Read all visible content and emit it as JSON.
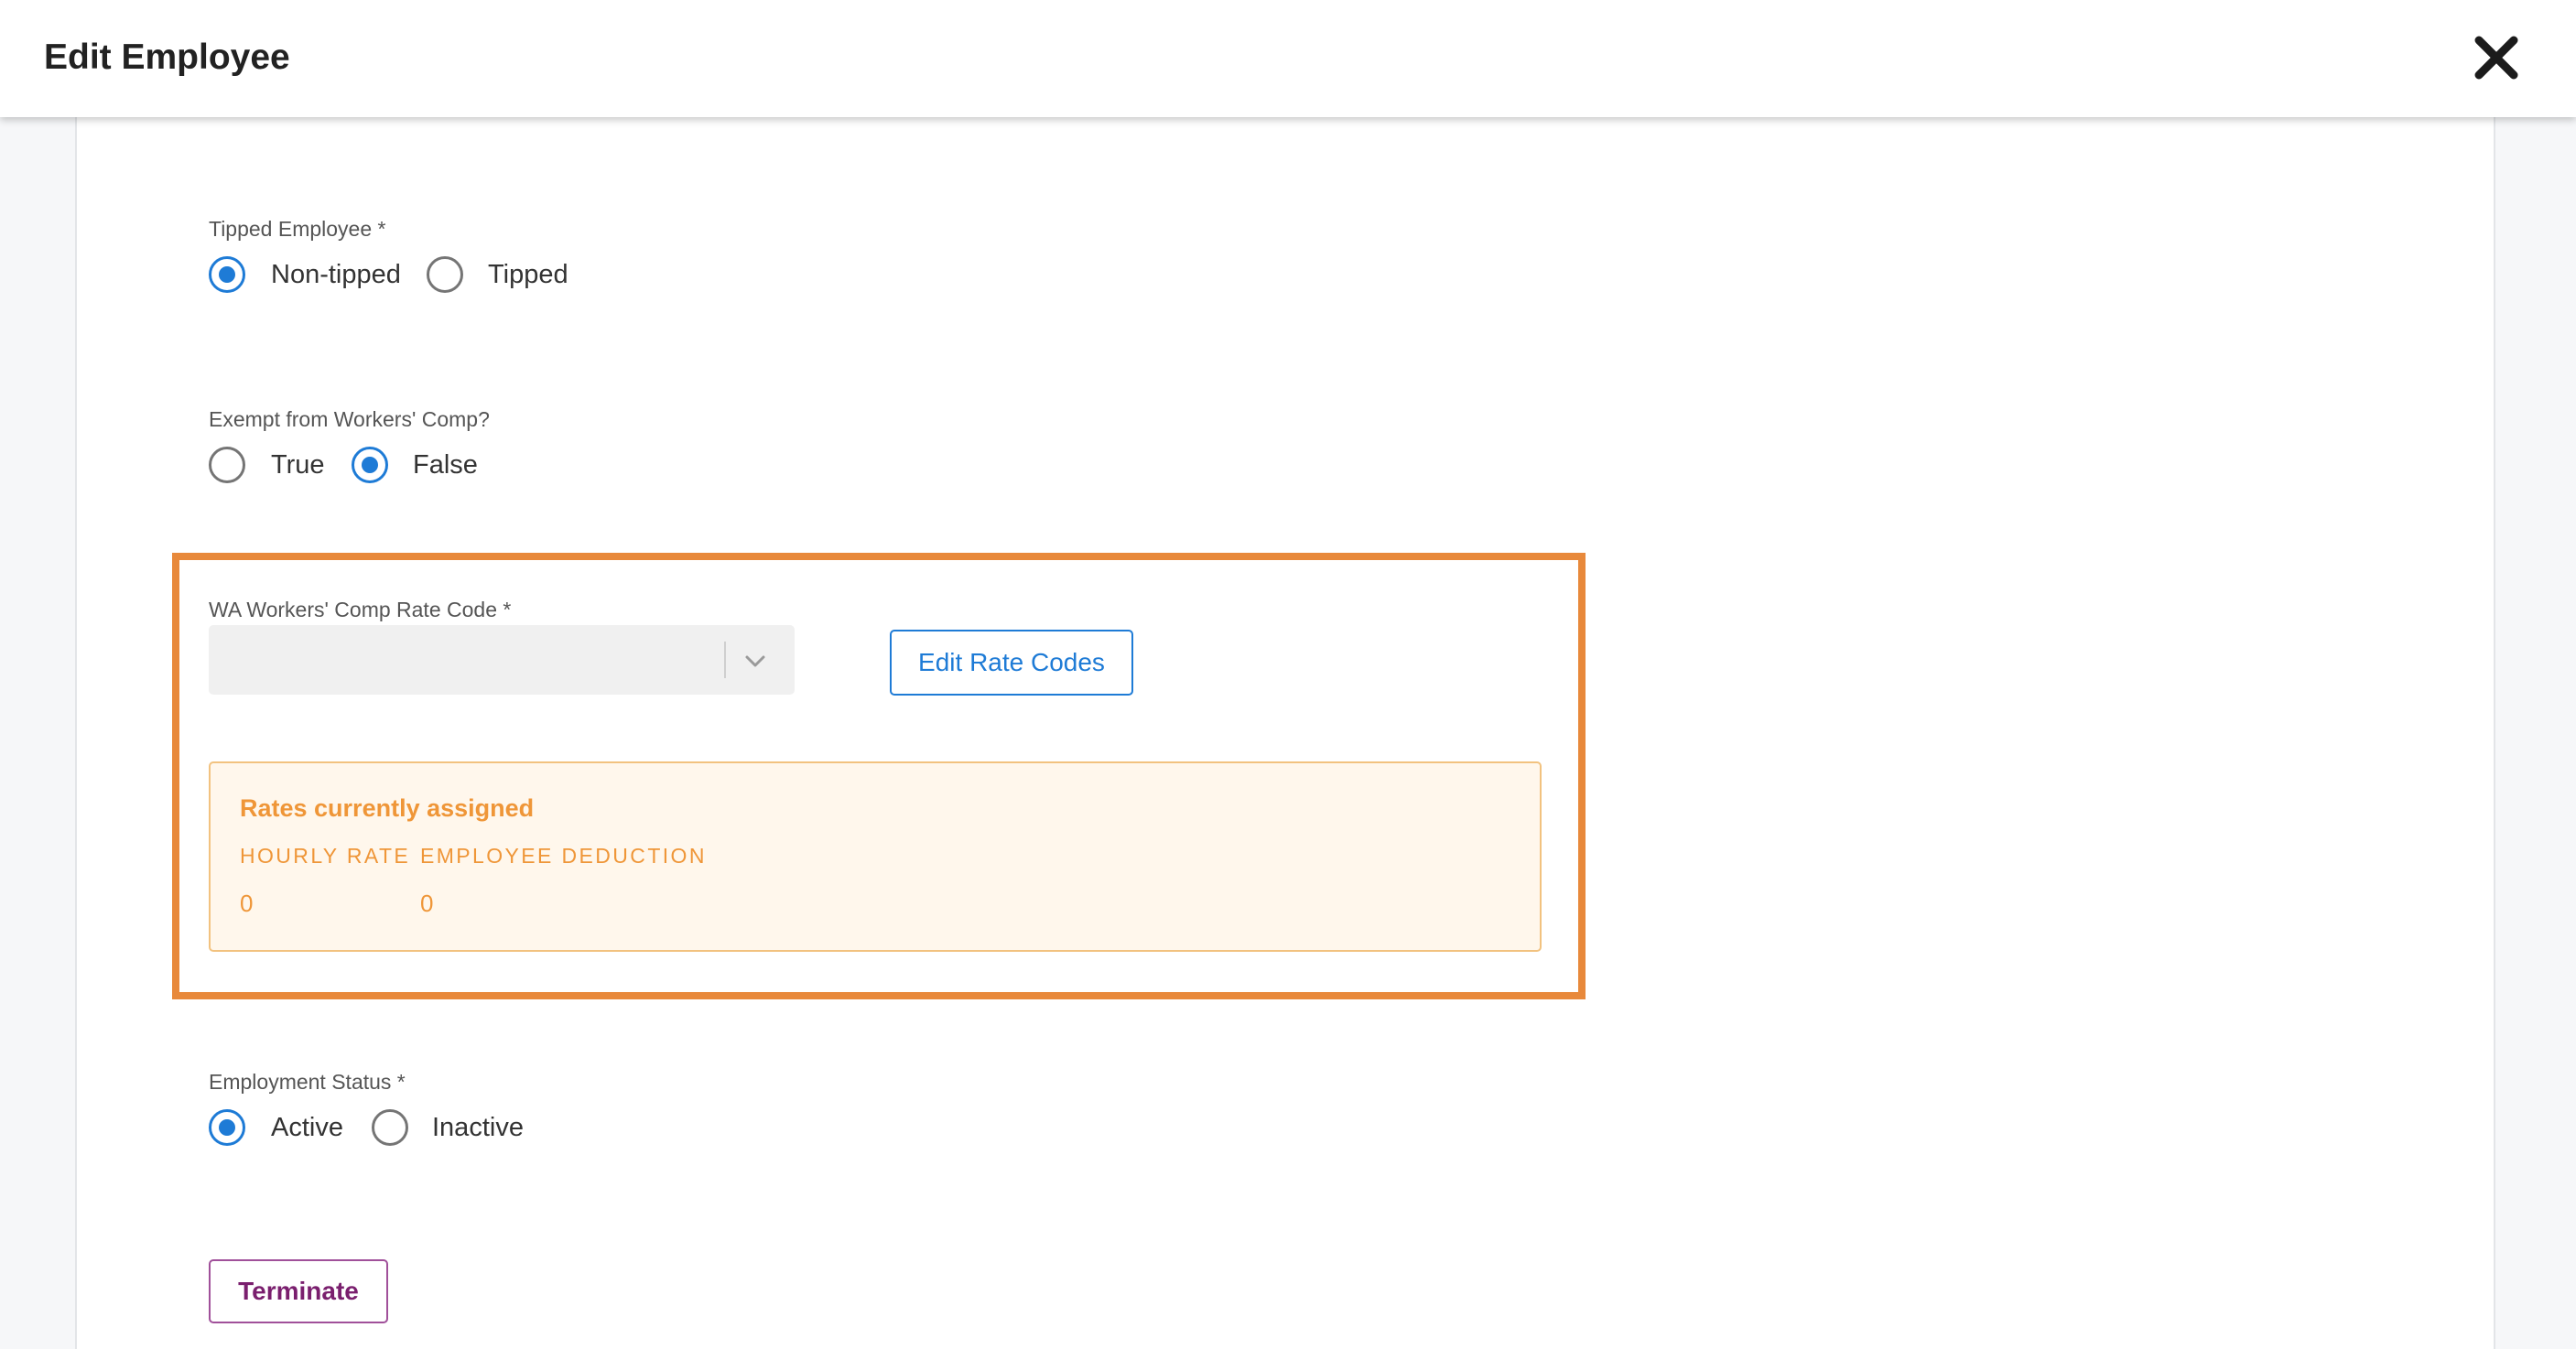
{
  "header": {
    "title": "Edit Employee",
    "close_icon": "close-icon"
  },
  "tipped": {
    "label": "Tipped Employee *",
    "options": [
      {
        "label": "Non-tipped",
        "selected": true
      },
      {
        "label": "Tipped",
        "selected": false
      }
    ]
  },
  "workers_comp_exempt": {
    "label": "Exempt from Workers' Comp?",
    "options": [
      {
        "label": "True",
        "selected": false
      },
      {
        "label": "False",
        "selected": true
      }
    ]
  },
  "rate_code": {
    "label": "WA Workers' Comp Rate Code *",
    "value": "",
    "edit_button": "Edit Rate Codes",
    "rates_box": {
      "title": "Rates currently assigned",
      "columns": [
        "HOURLY RATE",
        "EMPLOYEE DEDUCTION"
      ],
      "values": [
        "0",
        "0"
      ]
    }
  },
  "employment_status": {
    "label": "Employment Status *",
    "options": [
      {
        "label": "Active",
        "selected": true
      },
      {
        "label": "Inactive",
        "selected": false
      }
    ]
  },
  "terminate_button": "Terminate",
  "colors": {
    "accent": "#1e7bd6",
    "highlight": "#e8893b",
    "rates_text": "#ef9638",
    "terminate": "#7a1f6e"
  }
}
